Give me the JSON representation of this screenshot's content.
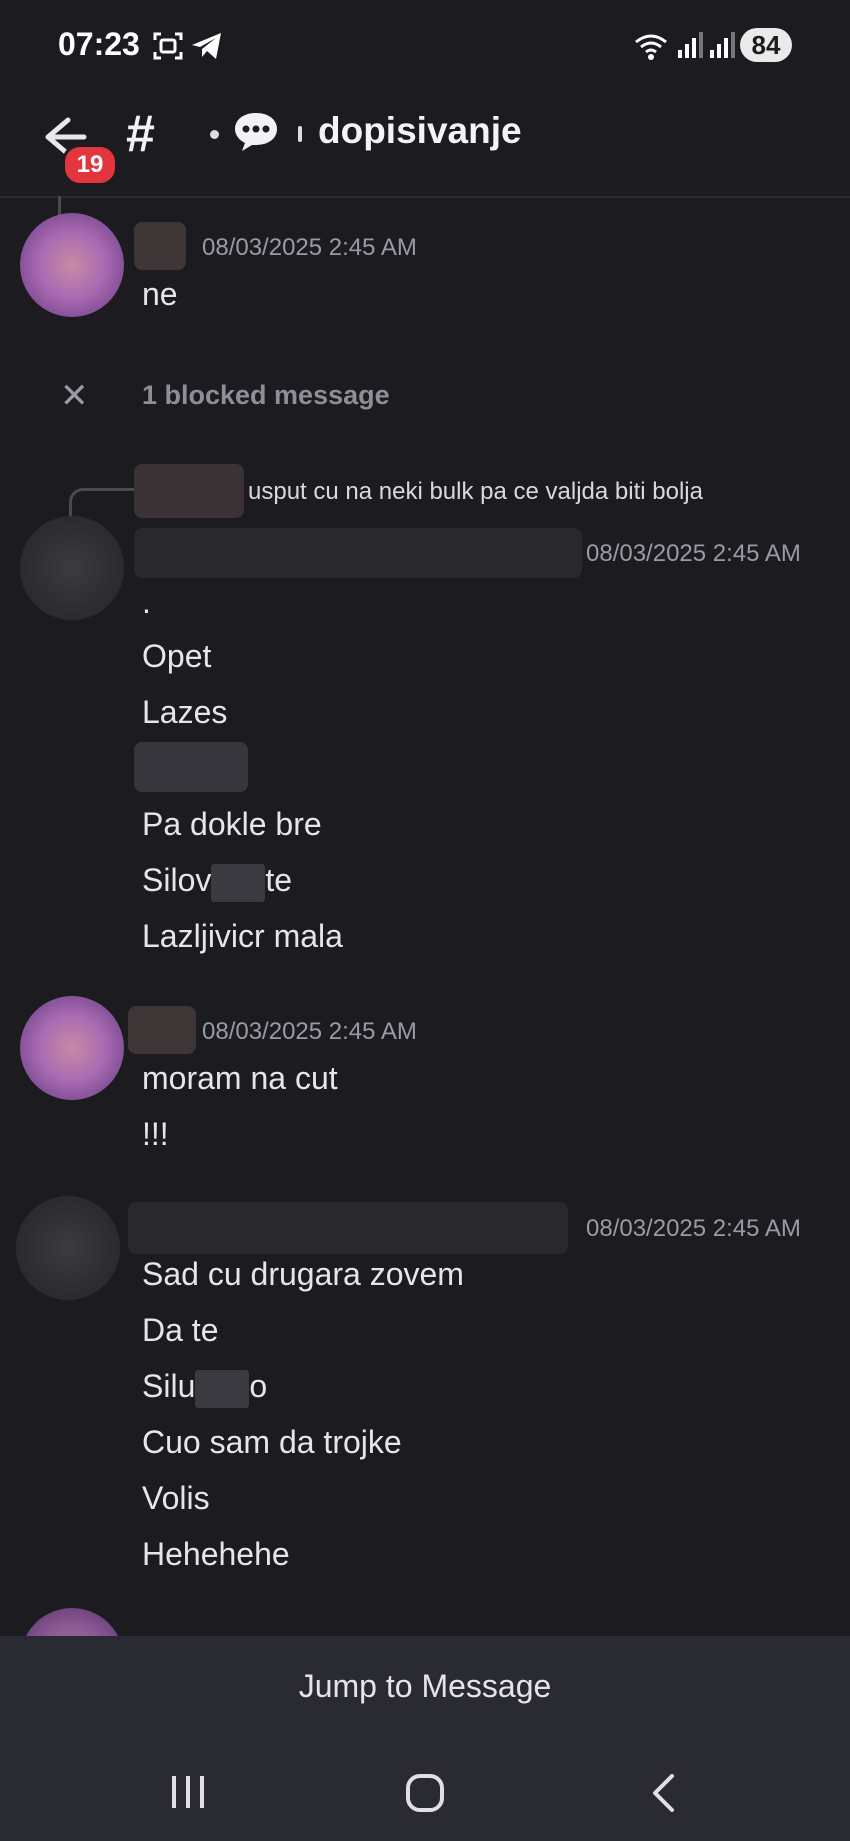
{
  "status_bar": {
    "time": "07:23",
    "icons": [
      "screenshot-icon",
      "telegram-icon",
      "wifi-icon",
      "signal-icon",
      "signal-icon"
    ],
    "battery": "84"
  },
  "header": {
    "badge_count": "19",
    "channel_name": "dopisivanje"
  },
  "messages": [
    {
      "timestamp": "08/03/2025 2:45 AM",
      "lines": [
        "ne"
      ]
    },
    {
      "blocked_label": "1 blocked message"
    },
    {
      "reply_text": "usput cu na neki bulk pa ce valjda biti bolja",
      "timestamp": "08/03/2025 2:45 AM",
      "lines": [
        ".",
        "Opet",
        "Lazes",
        "Pa dokle bre",
        "Silov",
        "te",
        "Lazljivicr mala"
      ]
    },
    {
      "timestamp": "08/03/2025 2:45 AM",
      "lines": [
        "moram na cut",
        "!!!"
      ]
    },
    {
      "timestamp": "08/03/2025 2:45 AM",
      "lines": [
        "Sad cu drugara zovem",
        "Da te",
        "Silu",
        "o",
        "Cuo sam da trojke",
        "Volis",
        "Hehehehe"
      ]
    }
  ],
  "jump_bar": {
    "label": "Jump to Message"
  },
  "nav": {
    "items": [
      "recent-apps-icon",
      "home-icon",
      "back-icon"
    ]
  },
  "colors": {
    "background": "#1b1b20",
    "badge": "#e3353d",
    "muted": "#9a9aa5"
  }
}
